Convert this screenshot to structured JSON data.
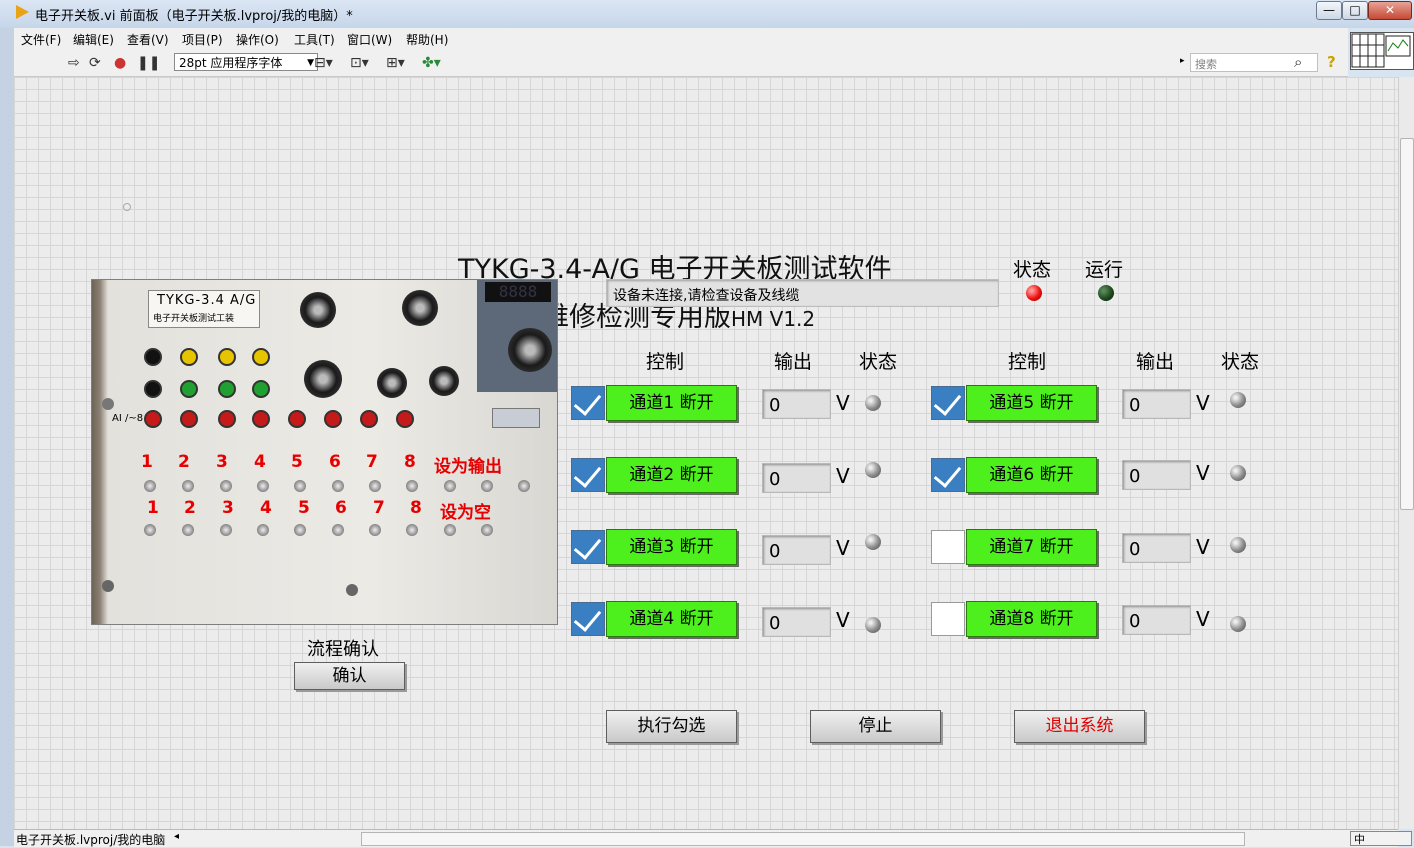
{
  "window": {
    "title": "电子开关板.vi 前面板（电子开关板.lvproj/我的电脑）*",
    "min": "—",
    "max": "□",
    "close": "✕"
  },
  "menu": [
    "文件(F)",
    "编辑(E)",
    "查看(V)",
    "项目(P)",
    "操作(O)",
    "工具(T)",
    "窗口(W)",
    "帮助(H)"
  ],
  "toolbar": {
    "font": "28pt 应用程序字体",
    "search_placeholder": "搜索"
  },
  "panel": {
    "title": "TYKG-3.4-A/G 电子开关板测试软件",
    "subtitle": "维修检测专用版",
    "subtitle_version": "HM V1.2",
    "status_message": "设备未连接,请检查设备及线缆",
    "status_led_label": "状态",
    "run_led_label": "运行",
    "flow_label": "流程确认",
    "confirm_button": "确认",
    "column_headers": {
      "control": "控制",
      "output": "输出",
      "status": "状态"
    },
    "unit": "V",
    "channels": [
      {
        "label": "通道1 断开",
        "checked": true,
        "value": "0"
      },
      {
        "label": "通道2 断开",
        "checked": true,
        "value": "0"
      },
      {
        "label": "通道3 断开",
        "checked": true,
        "value": "0"
      },
      {
        "label": "通道4 断开",
        "checked": true,
        "value": "0"
      },
      {
        "label": "通道5 断开",
        "checked": true,
        "value": "0"
      },
      {
        "label": "通道6 断开",
        "checked": true,
        "value": "0"
      },
      {
        "label": "通道7 断开",
        "checked": false,
        "value": "0"
      },
      {
        "label": "通道8 断开",
        "checked": false,
        "value": "0"
      }
    ],
    "execute_button": "执行勾选",
    "stop_button": "停止",
    "exit_button": "退出系统"
  },
  "photo": {
    "board_label": "TYKG-3.4 A/G",
    "board_sublabel": "电子开关板测试工装",
    "display": "8888",
    "row1_numbers": [
      "1",
      "2",
      "3",
      "4",
      "5",
      "6",
      "7",
      "8"
    ],
    "row1_note": "设为输出",
    "row2_numbers": [
      "1",
      "2",
      "3",
      "4",
      "5",
      "6",
      "7",
      "8"
    ],
    "row2_note": "设为空",
    "ai_label": "AI /~8"
  },
  "statusbar": {
    "path": "电子开关板.lvproj/我的电脑",
    "ime": "中"
  },
  "colors": {
    "channel_button": "#4df01c",
    "checkbox_on": "#3a7fc1",
    "exit_text": "#e00000",
    "led_status": "#ee1010",
    "led_run": "#1f4a1f"
  }
}
